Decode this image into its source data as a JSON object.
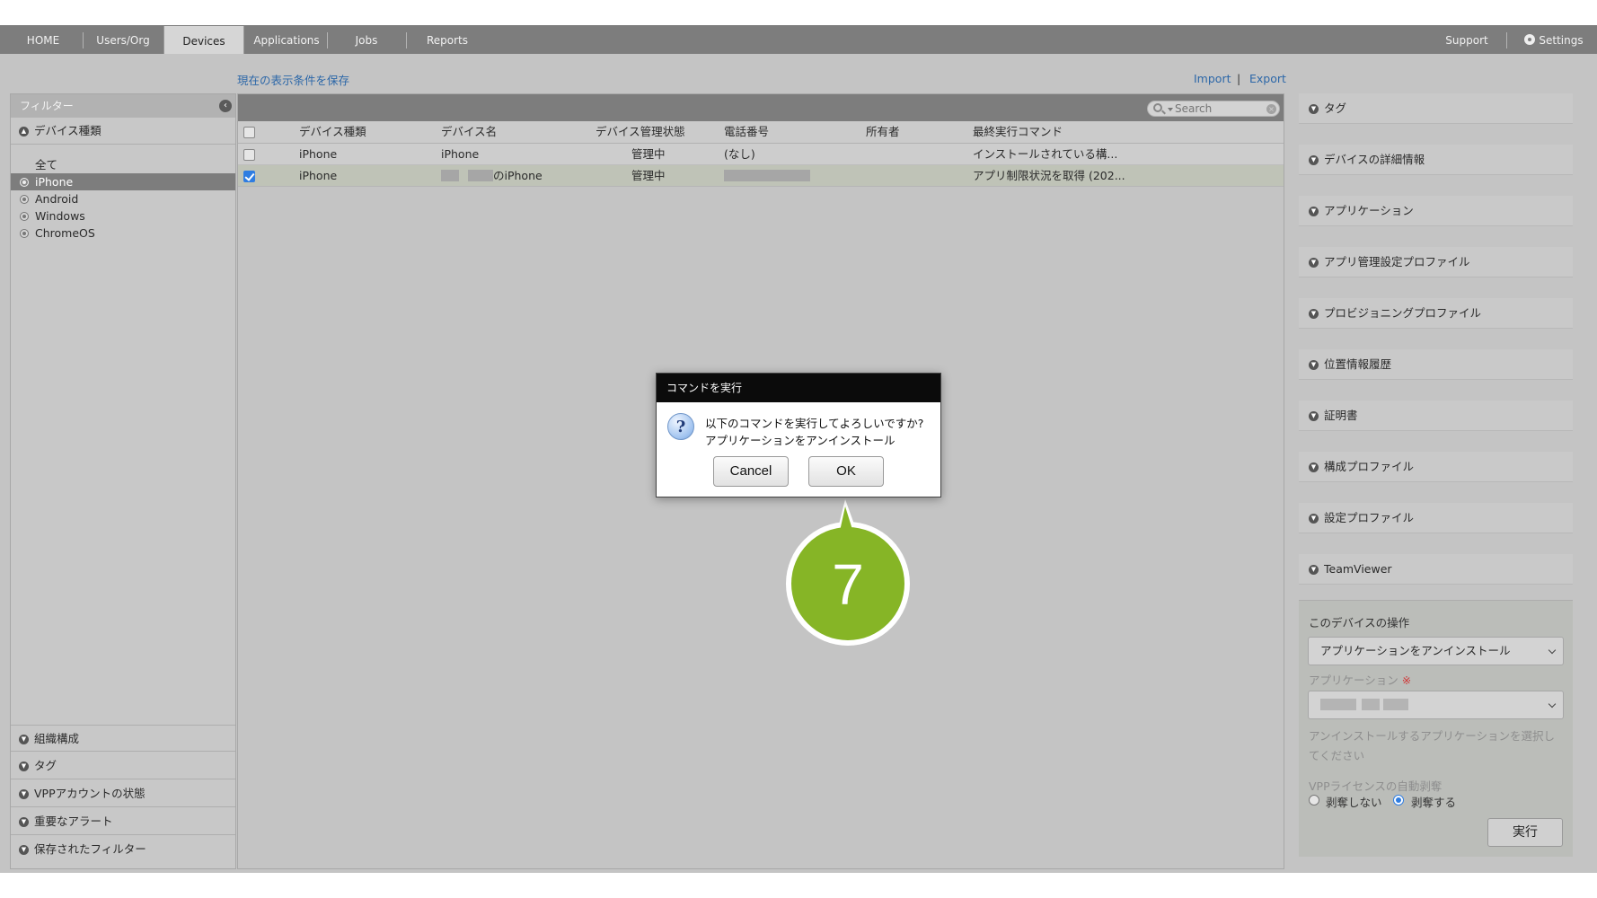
{
  "nav": {
    "tabs": [
      {
        "label": "HOME"
      },
      {
        "label": "Users/Org"
      },
      {
        "label": "Devices"
      },
      {
        "label": "Applications"
      },
      {
        "label": "Jobs"
      },
      {
        "label": "Reports"
      }
    ],
    "active_tab": "Devices",
    "support": "Support",
    "settings": "Settings"
  },
  "toolbar": {
    "save_view": "現在の表示条件を保存",
    "import": "Import",
    "separator": "|",
    "export": "Export"
  },
  "filter": {
    "title": "フィルター",
    "device_type_header": "デバイス種類",
    "types": [
      {
        "label": "全て"
      },
      {
        "label": "iPhone"
      },
      {
        "label": "Android"
      },
      {
        "label": "Windows"
      },
      {
        "label": "ChromeOS"
      }
    ],
    "selected_type": "iPhone",
    "bottom_sections": [
      {
        "label": "組織構成"
      },
      {
        "label": "タグ"
      },
      {
        "label": "VPPアカウントの状態"
      },
      {
        "label": "重要なアラート"
      },
      {
        "label": "保存されたフィルター"
      }
    ]
  },
  "search": {
    "placeholder": "Search"
  },
  "table": {
    "headers": [
      "デバイス種類",
      "デバイス名",
      "デバイス管理状態",
      "電話番号",
      "所有者",
      "最終実行コマンド"
    ],
    "rows": [
      {
        "checked": false,
        "type": "iPhone",
        "name": "iPhone",
        "status": "管理中",
        "phone": "(なし)",
        "owner": "",
        "last_command": "インストールされている構..."
      },
      {
        "checked": true,
        "type": "iPhone",
        "name": "のiPhone",
        "status": "管理中",
        "phone": "",
        "owner": "",
        "last_command": "アプリ制限状況を取得 (202..."
      }
    ]
  },
  "right": {
    "sections": [
      {
        "label": "タグ"
      },
      {
        "label": "デバイスの詳細情報"
      },
      {
        "label": "アプリケーション"
      },
      {
        "label": "アプリ管理設定プロファイル"
      },
      {
        "label": "プロビジョニングプロファイル"
      },
      {
        "label": "位置情報履歴"
      },
      {
        "label": "証明書"
      },
      {
        "label": "構成プロファイル"
      },
      {
        "label": "設定プロファイル"
      },
      {
        "label": "TeamViewer"
      }
    ],
    "actions": {
      "title": "このデバイスの操作",
      "command_value": "アプリケーションをアンインストール",
      "app_label": "アプリケーション",
      "required_mark": "※",
      "hint_line1": "アンインストールするアプリケーションを選択し",
      "hint_line2": "てください",
      "vpp_label": "VPPライセンスの自動剥奪",
      "radio_off": "剥奪しない",
      "radio_on": "剥奪する",
      "run": "実行"
    }
  },
  "dialog": {
    "title": "コマンドを実行",
    "message": "以下のコマンドを実行してよろしいですか?",
    "command": "アプリケーションをアンインストール",
    "cancel": "Cancel",
    "ok": "OK"
  },
  "callout": {
    "step": "7",
    "color": "#86b526"
  }
}
